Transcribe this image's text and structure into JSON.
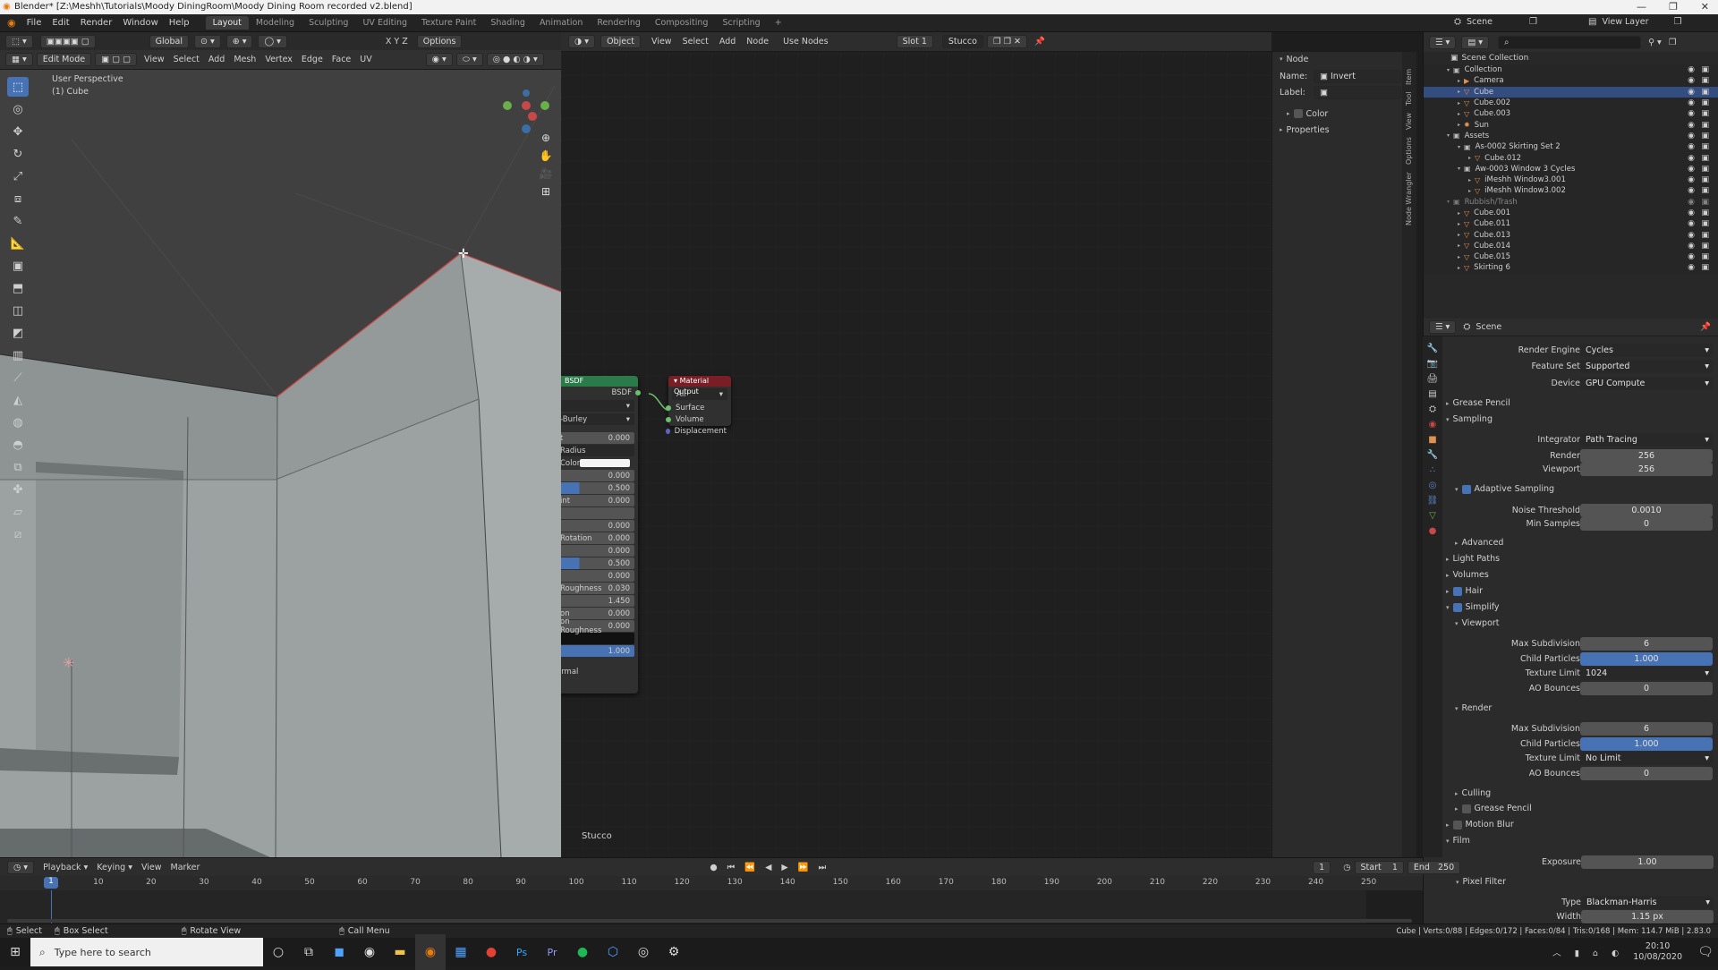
{
  "window": {
    "title": "Blender* [Z:\\Meshh\\Tutorials\\Moody DiningRoom\\Moody Dining Room recorded v2.blend]",
    "controls": [
      "—",
      "❐",
      "✕"
    ]
  },
  "menus": [
    "File",
    "Edit",
    "Render",
    "Window",
    "Help"
  ],
  "workspaces": [
    "Layout",
    "Modeling",
    "Sculpting",
    "UV Editing",
    "Texture Paint",
    "Shading",
    "Animation",
    "Rendering",
    "Compositing",
    "Scripting",
    "+"
  ],
  "top_right": {
    "scene": "Scene",
    "view_layer": "View Layer"
  },
  "viewport": {
    "mode": "Edit Mode",
    "menus": [
      "View",
      "Select",
      "Add",
      "Mesh",
      "Vertex",
      "Edge",
      "Face",
      "UV"
    ],
    "transform": "Global",
    "options": "Options",
    "axes": "X Y Z",
    "info1": "User Perspective",
    "info2": "(1) Cube"
  },
  "nodeeditor": {
    "type": "Object",
    "menus": [
      "View",
      "Select",
      "Add",
      "Node"
    ],
    "use_nodes": "Use Nodes",
    "slot": "Slot 1",
    "material": "Stucco",
    "footer": "Stucco",
    "bsdf": {
      "title": "BSDF",
      "out": "BSDF",
      "dropdown1": "",
      "method": "-Burley",
      "rows": [
        {
          "l": "t",
          "v": "0.000"
        },
        {
          "l": "Radius",
          "v": ""
        },
        {
          "l": "Color",
          "v": ""
        },
        {
          "l": "",
          "v": "0.000"
        },
        {
          "l": "",
          "v": "0.500"
        },
        {
          "l": "int",
          "v": "0.000"
        },
        {
          "l": "",
          "v": ""
        },
        {
          "l": "",
          "v": "0.000"
        },
        {
          "l": "Rotation",
          "v": "0.000"
        },
        {
          "l": "",
          "v": "0.000"
        },
        {
          "l": "",
          "v": "0.500"
        },
        {
          "l": "",
          "v": "0.000"
        },
        {
          "l": "Roughness",
          "v": "0.030"
        },
        {
          "l": "",
          "v": "1.450"
        },
        {
          "l": "on",
          "v": "0.000"
        },
        {
          "l": "on Roughness",
          "v": "0.000"
        },
        {
          "l": "",
          "v": ""
        },
        {
          "l": "",
          "v": "1.000"
        }
      ],
      "normal": "ormal"
    },
    "matout": {
      "title": "Material Output",
      "target": "All",
      "inputs": [
        "Surface",
        "Volume",
        "Displacement"
      ]
    }
  },
  "nodepanel": {
    "header": "Node",
    "name_label": "Name:",
    "name": "Invert",
    "label_label": "Label:",
    "color": "Color",
    "properties": "Properties",
    "tabs": [
      "Item",
      "Tool",
      "View",
      "Options",
      "Node Wrangler"
    ]
  },
  "outliner": {
    "root": "Scene Collection",
    "items": [
      {
        "name": "Collection",
        "indent": 1,
        "type": "coll"
      },
      {
        "name": "Camera",
        "indent": 2,
        "type": "cam"
      },
      {
        "name": "Cube",
        "indent": 2,
        "type": "mesh",
        "selected": true
      },
      {
        "name": "Cube.002",
        "indent": 2,
        "type": "mesh"
      },
      {
        "name": "Cube.003",
        "indent": 2,
        "type": "mesh"
      },
      {
        "name": "Sun",
        "indent": 2,
        "type": "light"
      },
      {
        "name": "Assets",
        "indent": 1,
        "type": "coll"
      },
      {
        "name": "As-0002 Skirting Set 2",
        "indent": 2,
        "type": "coll"
      },
      {
        "name": "Cube.012",
        "indent": 3,
        "type": "mesh"
      },
      {
        "name": "Aw-0003 Window 3 Cycles",
        "indent": 2,
        "type": "coll"
      },
      {
        "name": "iMeshh Window3.001",
        "indent": 3,
        "type": "mesh"
      },
      {
        "name": "iMeshh Window3.002",
        "indent": 3,
        "type": "mesh"
      },
      {
        "name": "Rubbish/Trash",
        "indent": 1,
        "type": "coll",
        "dim": true
      },
      {
        "name": "Cube.001",
        "indent": 2,
        "type": "mesh"
      },
      {
        "name": "Cube.011",
        "indent": 2,
        "type": "mesh"
      },
      {
        "name": "Cube.013",
        "indent": 2,
        "type": "mesh"
      },
      {
        "name": "Cube.014",
        "indent": 2,
        "type": "mesh"
      },
      {
        "name": "Cube.015",
        "indent": 2,
        "type": "mesh"
      },
      {
        "name": "Skirting 6",
        "indent": 2,
        "type": "mesh"
      }
    ]
  },
  "props": {
    "scene": "Scene",
    "render_engine_l": "Render Engine",
    "render_engine": "Cycles",
    "feature_set_l": "Feature Set",
    "feature_set": "Supported",
    "device_l": "Device",
    "device": "GPU Compute",
    "grease_pencil": "Grease Pencil",
    "sampling": "Sampling",
    "integrator_l": "Integrator",
    "integrator": "Path Tracing",
    "render_l": "Render",
    "render": "256",
    "viewport_l": "Viewport",
    "viewport": "256",
    "adaptive": "Adaptive Sampling",
    "noise_l": "Noise Threshold",
    "noise": "0.0010",
    "minsamp_l": "Min Samples",
    "minsamp": "0",
    "advanced": "Advanced",
    "light_paths": "Light Paths",
    "volumes": "Volumes",
    "hair": "Hair",
    "simplify": "Simplify",
    "vp_sub": "Viewport",
    "maxsub_l": "Max Subdivision",
    "maxsub": "6",
    "childp_l": "Child Particles",
    "childp": "1.000",
    "texlim_l": "Texture Limit",
    "texlim": "1024",
    "ao_l": "AO Bounces",
    "ao": "0",
    "r_sub": "Render",
    "r_maxsub": "6",
    "r_childp": "1.000",
    "r_texlim": "No Limit",
    "r_ao": "0",
    "culling": "Culling",
    "grease_pencil2": "Grease Pencil",
    "motion_blur": "Motion Blur",
    "film": "Film",
    "exposure_l": "Exposure",
    "exposure": "1.00",
    "pixel_filter": "Pixel Filter",
    "type_l": "Type",
    "type": "Blackman-Harris",
    "width_l": "Width",
    "width": "1.15 px"
  },
  "timeline": {
    "menus": [
      "Playback",
      "Keying",
      "View",
      "Marker"
    ],
    "frame": "1",
    "start_l": "Start",
    "start": "1",
    "end_l": "End",
    "end": "250",
    "current": "1",
    "ticks": [
      "10",
      "20",
      "30",
      "40",
      "50",
      "60",
      "70",
      "80",
      "90",
      "100",
      "110",
      "120",
      "130",
      "140",
      "150",
      "160",
      "170",
      "180",
      "190",
      "200",
      "210",
      "220",
      "230",
      "240",
      "250"
    ]
  },
  "statusbar": {
    "select": "Select",
    "box": "Box Select",
    "rotate": "Rotate View",
    "call": "Call Menu",
    "stats": "Cube | Verts:0/88 | Edges:0/172 | Faces:0/84 | Tris:0/168 | Mem: 114.7 MiB | 2.83.0"
  },
  "taskbar": {
    "search": "Type here to search",
    "time": "20:10",
    "date": "10/08/2020"
  },
  "colors": {
    "accent": "#4772b3",
    "shader_header": "#2a7a4a",
    "output_header": "#7a1e26"
  }
}
